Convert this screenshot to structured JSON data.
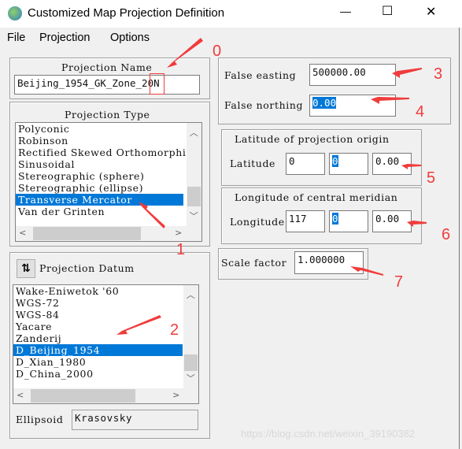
{
  "window": {
    "title": "Customized Map Projection Definition",
    "controls": [
      "—",
      "☐",
      "✕"
    ]
  },
  "menu": [
    "File",
    "Projection",
    "Options"
  ],
  "projection_name": {
    "label": "Projection Name",
    "value": "Beijing_1954_GK_Zone_20N"
  },
  "projection_type": {
    "label": "Projection Type",
    "items": [
      "Polyconic",
      "Robinson",
      "Rectified Skewed Orthomorphi",
      "Sinusoidal",
      "Stereographic (sphere)",
      "Stereographic (ellipse)",
      "Transverse Mercator",
      "Van der Grinten"
    ],
    "selected": "Transverse Mercator"
  },
  "datum": {
    "label": "Projection Datum",
    "items": [
      "Wake-Eniwetok '60",
      "WGS-72",
      "WGS-84",
      "Yacare",
      "Zanderij",
      "D_Beijing_1954",
      "D_Xian_1980",
      "D_China_2000"
    ],
    "selected": "D_Beijing_1954"
  },
  "ellipsoid": {
    "label": "Ellipsoid",
    "value": "Krasovsky"
  },
  "false_easting": {
    "label": "False easting",
    "value": "500000.00"
  },
  "false_northing": {
    "label": "False northing",
    "value": "0.00"
  },
  "latitude": {
    "title": "Latitude of projection origin",
    "label": "Latitude",
    "deg": "0",
    "min": "0",
    "sec": "0.00"
  },
  "longitude": {
    "title": "Longitude of central meridian",
    "label": "Longitude",
    "deg": "117",
    "min": "0",
    "sec": "0.00"
  },
  "scale_factor": {
    "label": "Scale factor",
    "value": "1.000000"
  },
  "annotations": [
    "0",
    "1",
    "2",
    "3",
    "4",
    "5",
    "6",
    "7"
  ],
  "watermark": "https://blog.csdn.net/weixin_39190382",
  "colors": {
    "selection": "#0078d7",
    "annotation": "#f03c3c"
  }
}
